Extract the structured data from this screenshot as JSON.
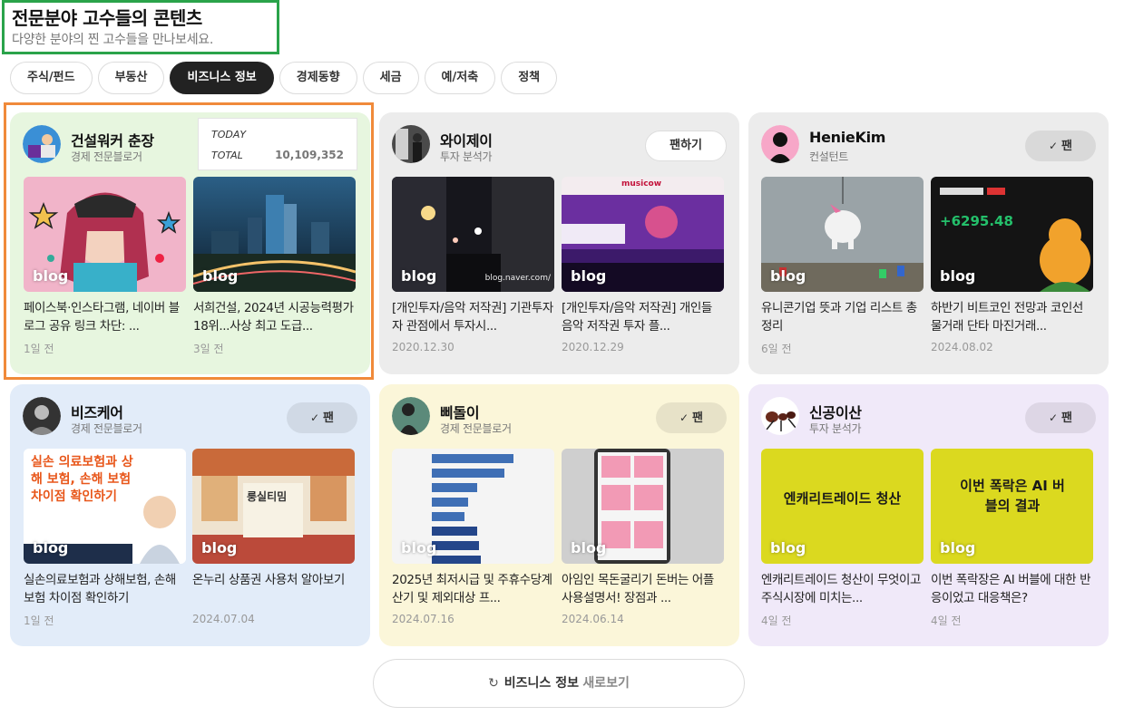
{
  "header": {
    "title": "전문분야 고수들의 콘텐츠",
    "subtitle": "다양한 분야의 찐 고수들을 만나보세요."
  },
  "tabs": [
    {
      "label": "주식/펀드",
      "active": false
    },
    {
      "label": "부동산",
      "active": false
    },
    {
      "label": "비즈니스 정보",
      "active": true
    },
    {
      "label": "경제동향",
      "active": false
    },
    {
      "label": "세금",
      "active": false
    },
    {
      "label": "예/저축",
      "active": false
    },
    {
      "label": "정책",
      "active": false
    }
  ],
  "blog_mark": "blog",
  "cards": [
    {
      "name": "건설워커 춘장",
      "role": "경제 전문블로거",
      "bg": "#e7f6df",
      "stats": {
        "today_label": "TODAY",
        "today_value": "",
        "total_label": "TOTAL",
        "total_value": "10,109,352"
      },
      "posts": [
        {
          "title": "페이스북·인스타그램, 네이버 블로그 공유 링크 차단: ...",
          "date": "1일 전"
        },
        {
          "title": "서희건설, 2024년 시공능력평가 18위...사상 최고 도급...",
          "date": "3일 전"
        }
      ]
    },
    {
      "name": "와이제이",
      "role": "투자 분석가",
      "bg": "#ececec",
      "button": "팬하기",
      "posts": [
        {
          "title": "[개인투자/음악 저작권] 기관투자자 관점에서 투자시...",
          "date": "2020.12.30",
          "overlay": "blog.naver.com/"
        },
        {
          "title": "[개인투자/음악 저작권] 개인들 음악 저작권 투자 플...",
          "date": "2020.12.29",
          "overlay": "musicow"
        }
      ]
    },
    {
      "name": "HenieKim",
      "role": "컨설턴트",
      "bg": "#ececec",
      "button": "팬",
      "posts": [
        {
          "title": "유니콘기업 뜻과 기업 리스트 총정리",
          "date": "6일 전"
        },
        {
          "title": "하반기 비트코인 전망과 코인선물거래 단타 마진거래...",
          "date": "2024.08.02",
          "overlay": "+6295.48"
        }
      ]
    },
    {
      "name": "비즈케어",
      "role": "경제 전문블로거",
      "bg": "#e2ecf9",
      "button": "팬",
      "posts": [
        {
          "title": "실손의료보험과 상해보험, 손해보험 차이점 확인하기",
          "date": "1일 전",
          "overlay": "실손 의료보험과 상해 보험, 손해 보험 차이점 확인하기"
        },
        {
          "title": "온누리 상품권 사용처 알아보기",
          "date": "2024.07.04",
          "overlay": "룽실티밈"
        }
      ]
    },
    {
      "name": "삐돌이",
      "role": "경제 전문블로거",
      "bg": "#fbf6d9",
      "button": "팬",
      "posts": [
        {
          "title": "2025년 최저시급 및 주휴수당계산기 및 제외대상 프...",
          "date": "2024.07.16"
        },
        {
          "title": "아임인 목돈굴리기 돈버는 어플 사용설명서! 장점과 ...",
          "date": "2024.06.14"
        }
      ]
    },
    {
      "name": "신공이산",
      "role": "투자 분석가",
      "bg": "#f0e9f9",
      "button": "팬",
      "posts": [
        {
          "title": "엔캐리트레이드 청산이 무엇이고 주식시장에 미치는...",
          "date": "4일 전",
          "overlay": "엔캐리트레이드 청산"
        },
        {
          "title": "이번 폭락장은 AI 버블에 대한 반응이었고 대응책은?",
          "date": "4일 전",
          "overlay": "이번 폭락은 AI 버블의 결과"
        }
      ]
    }
  ],
  "more": {
    "strong": "비즈니스 정보",
    "light": "새로보기"
  }
}
